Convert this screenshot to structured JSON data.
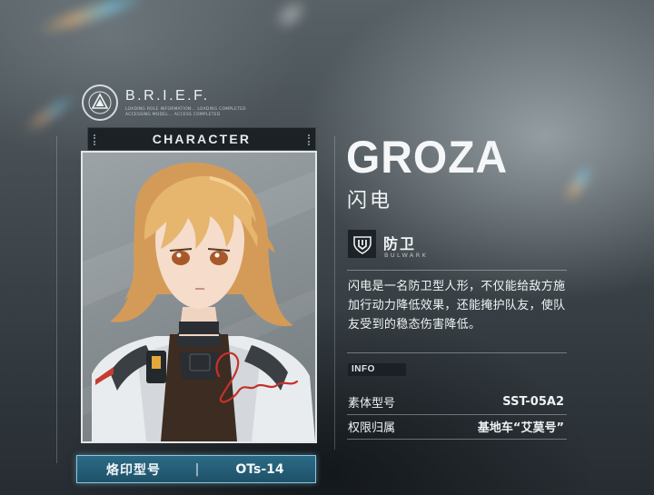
{
  "brief": {
    "title": "B.R.I.E.F.",
    "sub_lines": [
      "LOADING ROLE INFORMATION... LOADING COMPLETED",
      "ACCESSING MODEL... ACCESS COMPLETED"
    ],
    "logo_icon": "brief-emblem-icon"
  },
  "section_label": "CHARACTER",
  "character": {
    "name_en": "GROZA",
    "name_cn": "闪电",
    "role": {
      "icon": "bulwark-shield-icon",
      "cn": "防卫",
      "en": "BULWARK"
    },
    "description": "闪电是一名防卫型人形，不仅能给敌方施加行动力降低效果，还能掩护队友，使队友受到的稳态伤害降低。"
  },
  "info": {
    "tag": "INFO",
    "rows": [
      {
        "label": "素体型号",
        "value": "SST-05A2"
      },
      {
        "label": "权限归属",
        "value": "基地车“艾莫号”"
      }
    ]
  },
  "model_plate": {
    "label": "烙印型号",
    "separator": "|",
    "value": "OTs-14"
  },
  "colors": {
    "plate_blue": "#2c6a86",
    "plate_border": "#8cc6dd",
    "hair": "#e6b56e",
    "signature": "#c5322a"
  }
}
